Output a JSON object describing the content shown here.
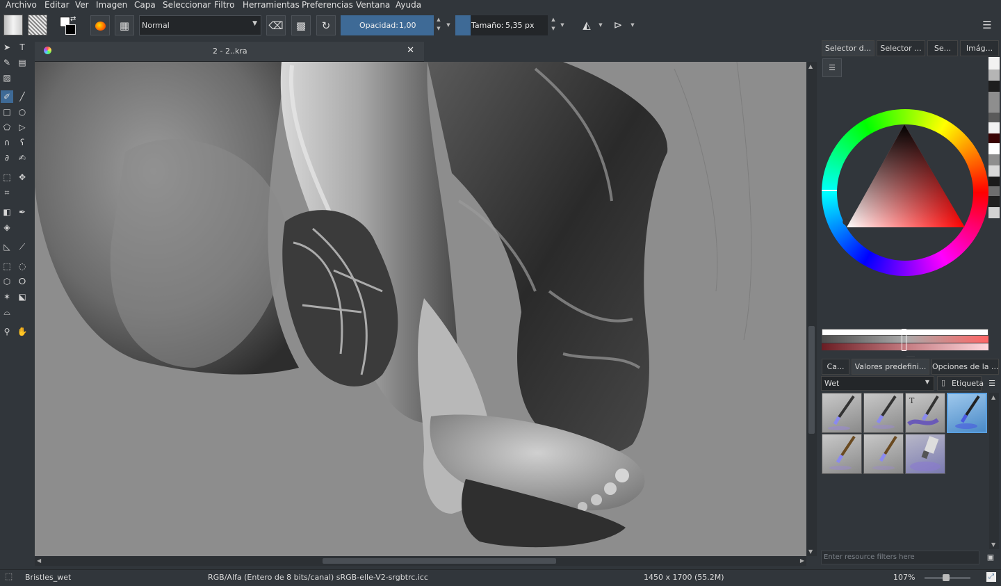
{
  "menu": [
    "Archivo",
    "Editar",
    "Ver",
    "Imagen",
    "Capa",
    "Seleccionar",
    "Filtro",
    "Herramientas",
    "Preferencias",
    "Ventana",
    "Ayuda"
  ],
  "toolbar": {
    "blend_mode": "Normal",
    "opacity_label": "Opacidad:",
    "opacity_value": "1,00",
    "opacity": 1.0,
    "size_label": "Tamaño:",
    "size_value": "5,35 px",
    "size_fill": 0.05
  },
  "document": {
    "tab_title": "2 - 2..kra"
  },
  "dock": {
    "top_tabs": [
      "Selector d...",
      "Selector ...",
      "Se...",
      "Imág..."
    ],
    "bottom_tabs": [
      "Ca...",
      "Valores predefini...",
      "Opciones de la ..."
    ],
    "preset_filter": "Wet",
    "tag_label": "Etiqueta",
    "resource_filter_placeholder": "Enter resource filters here",
    "presets": [
      "wet-brush-1",
      "wet-brush-2",
      "wet-text-brush",
      "wet-brush-selected",
      "wet-brush-5",
      "wet-brush-6",
      "wet-tube"
    ],
    "selected_preset": 3,
    "fg_color": "#ffffff",
    "accent": "#3e6a96"
  },
  "status": {
    "brush": "Bristles_wet",
    "color_space": "RGB/Alfa (Entero de 8 bits/canal)  sRGB-elle-V2-srgbtrc.icc",
    "dimensions": "1450 x 1700 (55.2M)",
    "zoom": "107%"
  }
}
